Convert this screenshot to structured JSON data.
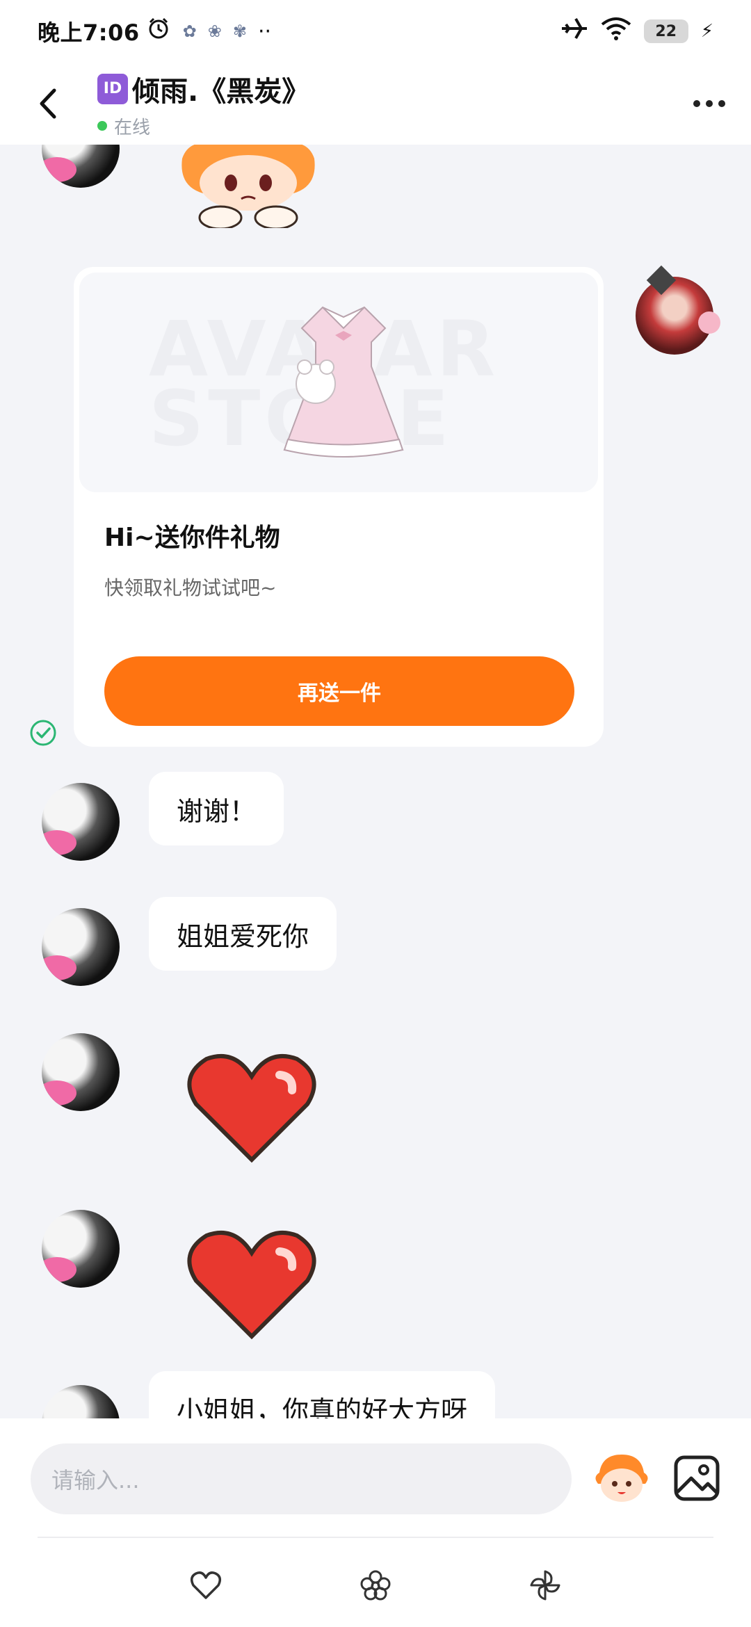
{
  "status_bar": {
    "time": "晚上7:06",
    "battery": "22",
    "more_dots": "··"
  },
  "header": {
    "id_badge": "ID",
    "name": "倾雨.《黑炭》",
    "status": "在线"
  },
  "gift_card": {
    "title": "Hi~送你件礼物",
    "subtitle": "快领取礼物试试吧~",
    "button": "再送一件",
    "watermark": "AVATAR STORE"
  },
  "messages": [
    {
      "text": "谢谢！"
    },
    {
      "text": "姐姐爱死你"
    },
    {
      "text": "小姐姐，你真的好大方呀"
    }
  ],
  "input": {
    "placeholder": "请输入..."
  },
  "colors": {
    "accent": "#FF7411",
    "online": "#3CC85A",
    "chat_bg": "#F3F4F8",
    "check": "#2BB673"
  }
}
